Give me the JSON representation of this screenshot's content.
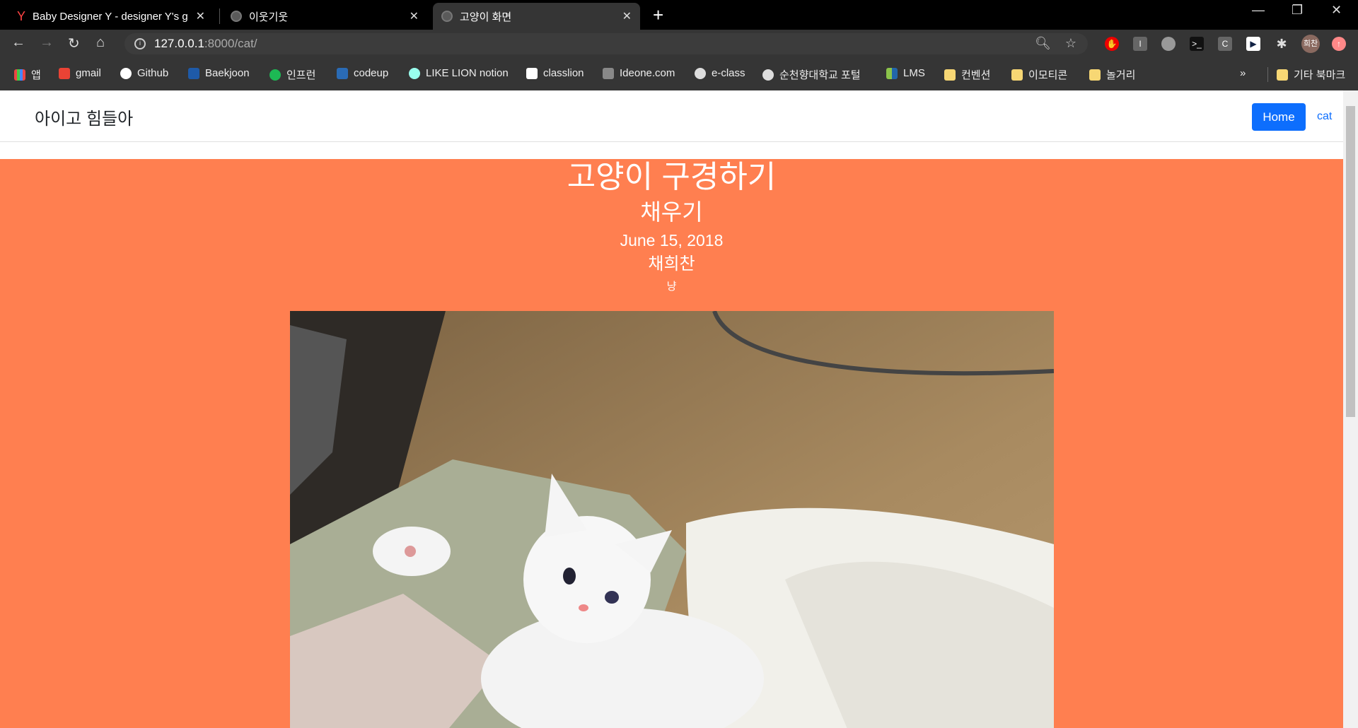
{
  "tabs": [
    {
      "title": "Baby Designer Y - designer Y's g",
      "icon": "Y"
    },
    {
      "title": "이웃기웃"
    },
    {
      "title": "고양이 화면"
    }
  ],
  "toolbar": {
    "url_host": "127.0.0.1",
    "url_rest": ":8000/cat/",
    "profile": "희찬"
  },
  "bookmarks": [
    {
      "label": "앱",
      "color": "#e44"
    },
    {
      "label": "gmail",
      "color": "#ea4335"
    },
    {
      "label": "Github",
      "color": "#fff"
    },
    {
      "label": "Baekjoon",
      "color": "#1e5aa8"
    },
    {
      "label": "인프런",
      "color": "#1db954"
    },
    {
      "label": "codeup",
      "color": "#2a6bb5"
    },
    {
      "label": "LIKE LION notion",
      "color": "#9fe"
    },
    {
      "label": "classlion",
      "color": "#fff"
    },
    {
      "label": "Ideone.com",
      "color": "#888"
    },
    {
      "label": "e-class",
      "color": "#ddd"
    },
    {
      "label": "순천향대학교 포털",
      "color": "#ddd"
    },
    {
      "label": "LMS",
      "color": "#4caf50"
    },
    {
      "label": "컨벤션",
      "color": "#f7d774"
    },
    {
      "label": "이모티콘",
      "color": "#f7d774"
    },
    {
      "label": "놀거리",
      "color": "#7a5cff"
    }
  ],
  "bookmarks_more": "»",
  "other_bookmarks": "기타 북마크",
  "navbar": {
    "brand": "아이고 힘들아",
    "home": "Home",
    "cat": "cat"
  },
  "post": {
    "title": "고양이 구경하기",
    "subtitle": "채우기",
    "date": "June 15, 2018",
    "author": "채희찬",
    "text": "냥"
  },
  "colors": {
    "hero": "#FF7F50",
    "primary": "#0d6efd"
  }
}
